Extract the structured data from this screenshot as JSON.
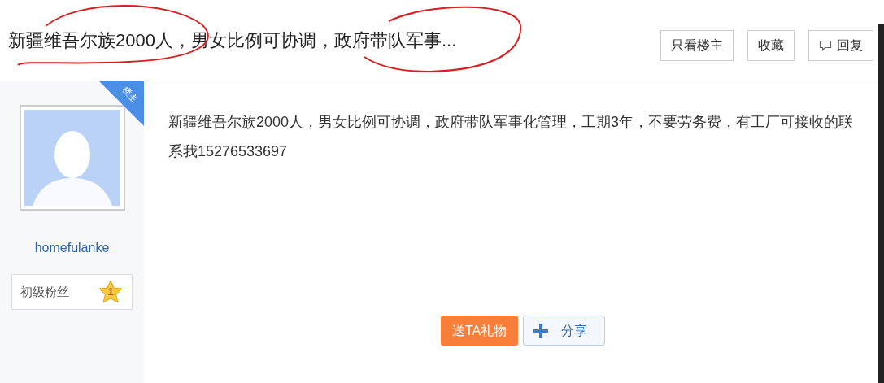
{
  "thread": {
    "title": "新疆维吾尔族2000人，男女比例可协调，政府带队军事..."
  },
  "actions": [
    {
      "kind": "plain",
      "label": "只看楼主"
    },
    {
      "kind": "plain",
      "label": "收藏"
    },
    {
      "kind": "reply",
      "label": "回复"
    }
  ],
  "author": {
    "badge": "楼主",
    "username": "homefulanke",
    "level_name": "初级粉丝",
    "level": "1"
  },
  "post": {
    "body": "新疆维吾尔族2000人，男女比例可协调，政府带队军事化管理，工期3年，不要劳务费，有工厂可接收的联系我15276533697"
  },
  "post_actions": [
    {
      "kind": "gift",
      "label": "送TA礼物"
    },
    {
      "kind": "share",
      "label": "分享"
    }
  ]
}
